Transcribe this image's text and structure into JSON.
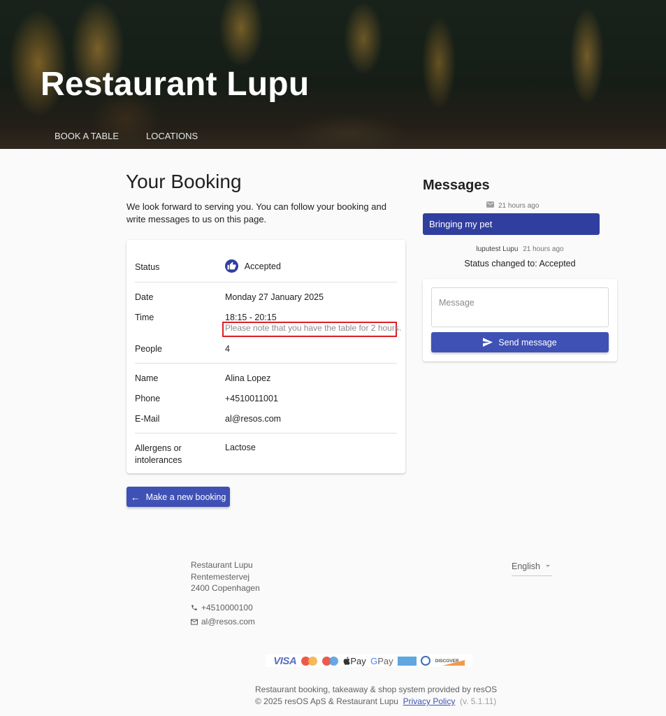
{
  "header": {
    "title": "Restaurant Lupu",
    "nav": [
      {
        "label": "BOOK A TABLE"
      },
      {
        "label": "LOCATIONS"
      }
    ]
  },
  "booking": {
    "title": "Your Booking",
    "intro": "We look forward to serving you. You can follow your booking and write messages to us on this page.",
    "status": {
      "label": "Status",
      "value": "Accepted",
      "icon": "thumbs-up-icon"
    },
    "date": {
      "label": "Date",
      "value": "Monday 27 January 2025"
    },
    "time": {
      "label": "Time",
      "value": "18:15 - 20:15",
      "note": "Please note that you have the table for 2 hours."
    },
    "people": {
      "label": "People",
      "value": "4"
    },
    "name": {
      "label": "Name",
      "value": "Alina Lopez"
    },
    "phone": {
      "label": "Phone",
      "value": "+4510011001"
    },
    "email": {
      "label": "E-Mail",
      "value": "al@resos.com"
    },
    "allergens": {
      "label": "Allergens or intolerances",
      "value": "Lactose"
    },
    "new_booking_button": "Make a new booking"
  },
  "messages": {
    "title": "Messages",
    "items": [
      {
        "icon": "envelope-icon",
        "time": "21 hours ago",
        "text": "Bringing my pet"
      },
      {
        "author": "luputest Lupu",
        "time": "21 hours ago",
        "text": "Status changed to: Accepted"
      }
    ],
    "input_placeholder": "Message",
    "input_value": "",
    "send_button": "Send message"
  },
  "footer": {
    "address": [
      "Restaurant Lupu",
      "Rentemestervej",
      "2400 Copenhagen"
    ],
    "phone": "+4510000100",
    "email": "al@resos.com",
    "language": "English",
    "payment_methods": [
      "VISA",
      "Mastercard",
      "Maestro",
      "Apple Pay",
      "Google Pay",
      "American Express",
      "Diners Club",
      "Discover"
    ],
    "payment_labels": {
      "visa": "VISA",
      "apay": "Pay",
      "gpay_g": "G",
      "gpay": " Pay",
      "discover": "DISCOVER"
    },
    "powered_by": "Restaurant booking, takeaway & shop system provided by resOS",
    "copyright": "© 2025 resOS ApS & Restaurant Lupu",
    "privacy_link": "Privacy Policy",
    "version": "(v. 5.1.11)"
  },
  "colors": {
    "primary": "#3f51b5",
    "bubble": "#303f9f",
    "highlight_border": "#e01e25"
  }
}
